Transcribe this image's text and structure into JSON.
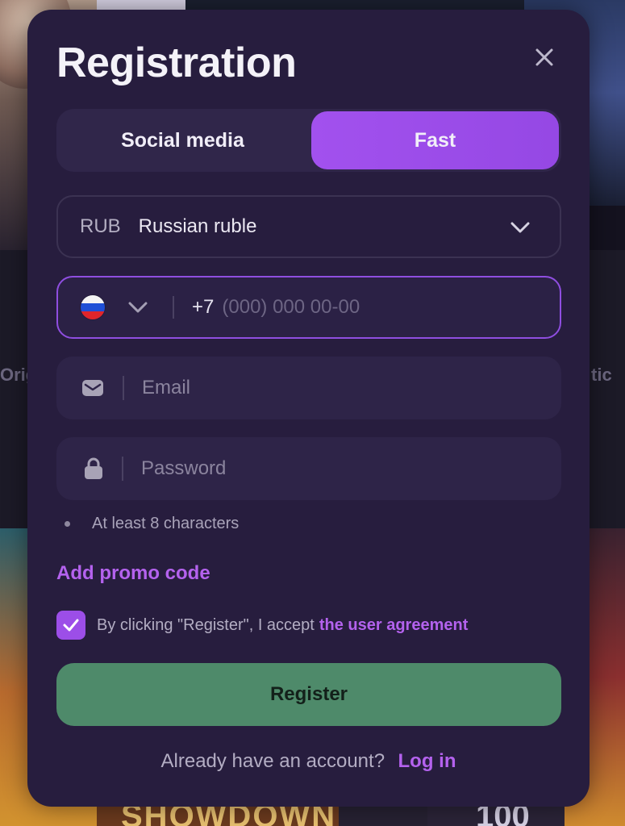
{
  "background": {
    "left_label": "Orig",
    "right_label": "tic",
    "tile_bottom_left_text": "SHOWDOWN",
    "tile_bottom_right_text": "100"
  },
  "modal": {
    "title": "Registration",
    "close_icon": "close-icon",
    "tabs": [
      {
        "label": "Social media",
        "active": false
      },
      {
        "label": "Fast",
        "active": true
      }
    ],
    "currency": {
      "code": "RUB",
      "name": "Russian ruble",
      "icon": "chevron-down-icon"
    },
    "phone": {
      "country_flag": "russia-flag-icon",
      "prefix": "+7",
      "placeholder": "(000) 000 00-00"
    },
    "email": {
      "icon": "envelope-icon",
      "placeholder": "Email"
    },
    "password": {
      "icon": "lock-icon",
      "placeholder": "Password",
      "hint": "At least 8 characters"
    },
    "promo_label": "Add promo code",
    "agreement": {
      "checked": true,
      "text": "By clicking \"Register\", I accept",
      "link": "the user agreement"
    },
    "register_label": "Register",
    "footer": {
      "question": "Already have an account?",
      "login_label": "Log in"
    }
  },
  "colors": {
    "modal_bg": "#271d3e",
    "accent_purple": "#9c4ee8",
    "link_purple": "#b462ee",
    "register_green": "#4e8a6a"
  }
}
